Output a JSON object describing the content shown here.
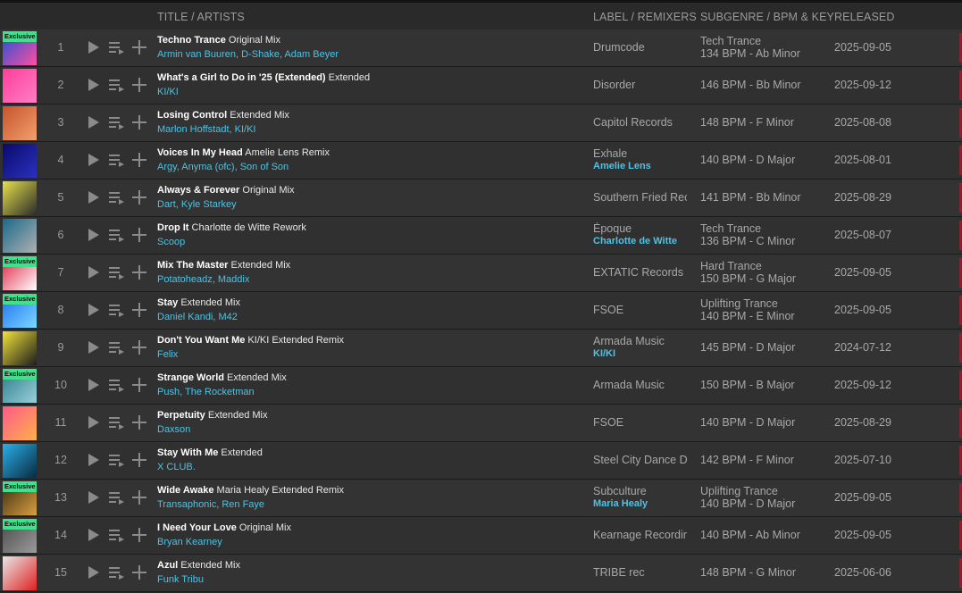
{
  "header": {
    "title_artists": "TITLE / ARTISTS",
    "label_remixers": "LABEL / REMIXERS",
    "subgenre_bpm_key": "SUBGENRE / BPM & KEY",
    "released": "RELEASED"
  },
  "exclusive_label": "Exclusive",
  "tracks": [
    {
      "num": "1",
      "title": "Techno Trance",
      "mix": "Original Mix",
      "artists": "Armin van Buuren, D-Shake, Adam Beyer",
      "label": "Drumcode",
      "remixers": "",
      "subgenre": "Tech Trance",
      "bpm_key": "134 BPM - Ab Minor",
      "released": "2025-09-05",
      "exclusive": true,
      "art_colors": [
        "#1d4fd8",
        "#ff4fa1"
      ]
    },
    {
      "num": "2",
      "title": "What's a Girl to Do in '25 (Extended)",
      "mix": "Extended",
      "artists": "KI/KI",
      "label": "Disorder",
      "remixers": "",
      "subgenre": "",
      "bpm_key": "146 BPM - Bb Minor",
      "released": "2025-09-12",
      "exclusive": false,
      "art_colors": [
        "#ff3d9a",
        "#ff7fc4"
      ]
    },
    {
      "num": "3",
      "title": "Losing Control",
      "mix": "Extended Mix",
      "artists": "Marlon Hoffstadt, KI/KI",
      "label": "Capitol Records",
      "remixers": "",
      "subgenre": "",
      "bpm_key": "148 BPM - F Minor",
      "released": "2025-08-08",
      "exclusive": false,
      "art_colors": [
        "#c8542a",
        "#f0a070"
      ]
    },
    {
      "num": "4",
      "title": "Voices In My Head",
      "mix": "Amelie Lens Remix",
      "artists": "Argy, Anyma (ofc), Son of Son",
      "label": "Exhale",
      "remixers": "Amelie Lens",
      "subgenre": "",
      "bpm_key": "140 BPM - D Major",
      "released": "2025-08-01",
      "exclusive": false,
      "art_colors": [
        "#0a0a6a",
        "#2a30c0"
      ]
    },
    {
      "num": "5",
      "title": "Always & Forever",
      "mix": "Original Mix",
      "artists": "Dart, Kyle Starkey",
      "label": "Southern Fried Recc",
      "remixers": "",
      "subgenre": "",
      "bpm_key": "141 BPM - Bb Minor",
      "released": "2025-08-29",
      "exclusive": false,
      "art_colors": [
        "#e6e14a",
        "#2a2a2a"
      ]
    },
    {
      "num": "6",
      "title": "Drop It",
      "mix": "Charlotte de Witte Rework",
      "artists": "Scoop",
      "label": "Époque",
      "remixers": "Charlotte de Witte",
      "subgenre": "Tech Trance",
      "bpm_key": "136 BPM - C Minor",
      "released": "2025-08-07",
      "exclusive": false,
      "art_colors": [
        "#1a6a8a",
        "#b0b0b0"
      ]
    },
    {
      "num": "7",
      "title": "Mix The Master",
      "mix": "Extended Mix",
      "artists": "Potatoheadz, Maddix",
      "label": "EXTATIC Records",
      "remixers": "",
      "subgenre": "Hard Trance",
      "bpm_key": "150 BPM - G Major",
      "released": "2025-09-05",
      "exclusive": true,
      "art_colors": [
        "#e02040",
        "#ffffff"
      ]
    },
    {
      "num": "8",
      "title": "Stay",
      "mix": "Extended Mix",
      "artists": "Daniel Kandi, M42",
      "label": "FSOE",
      "remixers": "",
      "subgenre": "Uplifting Trance",
      "bpm_key": "140 BPM - E Minor",
      "released": "2025-09-05",
      "exclusive": true,
      "art_colors": [
        "#1e6ff0",
        "#7ad8ff"
      ]
    },
    {
      "num": "9",
      "title": "Don't You Want Me",
      "mix": "KI/KI Extended Remix",
      "artists": "Felix",
      "label": "Armada Music",
      "remixers": "KI/KI",
      "subgenre": "",
      "bpm_key": "145 BPM - D Major",
      "released": "2024-07-12",
      "exclusive": false,
      "art_colors": [
        "#f2e23a",
        "#1c1c1c"
      ]
    },
    {
      "num": "10",
      "title": "Strange World",
      "mix": "Extended Mix",
      "artists": "Push, The Rocketman",
      "label": "Armada Music",
      "remixers": "",
      "subgenre": "",
      "bpm_key": "150 BPM - B Major",
      "released": "2025-09-12",
      "exclusive": true,
      "art_colors": [
        "#2a7a8a",
        "#9ad0d8"
      ]
    },
    {
      "num": "11",
      "title": "Perpetuity",
      "mix": "Extended Mix",
      "artists": "Daxson",
      "label": "FSOE",
      "remixers": "",
      "subgenre": "",
      "bpm_key": "140 BPM - D Major",
      "released": "2025-08-29",
      "exclusive": false,
      "art_colors": [
        "#ff5a8a",
        "#ffb04a"
      ]
    },
    {
      "num": "12",
      "title": "Stay With Me",
      "mix": "Extended",
      "artists": "X CLUB.",
      "label": "Steel City Dance Dis",
      "remixers": "",
      "subgenre": "",
      "bpm_key": "142 BPM - F Minor",
      "released": "2025-07-10",
      "exclusive": false,
      "art_colors": [
        "#2ab0e8",
        "#0a2a40"
      ]
    },
    {
      "num": "13",
      "title": "Wide Awake",
      "mix": "Maria Healy Extended Remix",
      "artists": "Transaphonic, Ren Faye",
      "label": "Subculture",
      "remixers": "Maria Healy",
      "subgenre": "Uplifting Trance",
      "bpm_key": "140 BPM - D Major",
      "released": "2025-09-05",
      "exclusive": true,
      "art_colors": [
        "#3a2a10",
        "#d8a040"
      ]
    },
    {
      "num": "14",
      "title": "I Need Your Love",
      "mix": "Original Mix",
      "artists": "Bryan Kearney",
      "label": "Kearnage Recordings",
      "remixers": "",
      "subgenre": "",
      "bpm_key": "140 BPM - Ab Minor",
      "released": "2025-09-05",
      "exclusive": true,
      "art_colors": [
        "#4a4a4a",
        "#9a9a9a"
      ]
    },
    {
      "num": "15",
      "title": "Azul",
      "mix": "Extended Mix",
      "artists": "Funk Tribu",
      "label": "TRIBE rec",
      "remixers": "",
      "subgenre": "",
      "bpm_key": "148 BPM - G Minor",
      "released": "2025-06-06",
      "exclusive": false,
      "art_colors": [
        "#e8e8e8",
        "#e02020"
      ]
    }
  ]
}
